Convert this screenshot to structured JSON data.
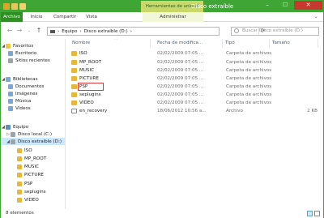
{
  "window": {
    "title": "Disco extraíble (D:)",
    "context_tab": "Herramientas de unidad",
    "accent": "#3fa535",
    "controls": {
      "minimize": "–",
      "maximize": "☐",
      "close": "✕"
    }
  },
  "ribbon": {
    "tabs": [
      "Archivo",
      "Inicio",
      "Compartir",
      "Vista",
      "Administrar"
    ]
  },
  "address": {
    "path": [
      "Equipo",
      "Disco extraíble (D:)"
    ],
    "search_placeholder": "Buscar Disco extraíble (D:)"
  },
  "nav_pane": {
    "favorites": {
      "label": "Favoritos",
      "items": [
        "Escritorio",
        "Sitios recientes"
      ]
    },
    "libraries": {
      "label": "Bibliotecas",
      "items": [
        "Documentos",
        "Imágenes",
        "Música",
        "Vídeos"
      ]
    },
    "computer": {
      "label": "Equipo",
      "drives": [
        "Disco local (C:)",
        "Disco extraíble (D:)"
      ],
      "subfolders": [
        "ISO",
        "MP_ROOT",
        "MUSIC",
        "PICTURE",
        "PSP",
        "seplugins",
        "VIDEO"
      ]
    }
  },
  "columns": {
    "name": "Nombre",
    "date": "Fecha de modifica...",
    "type": "Tipo",
    "size": "Tamaño"
  },
  "files": [
    {
      "name": "ISO",
      "date": "02/02/2009 07:05 ...",
      "type": "Carpeta de archivos",
      "size": "",
      "kind": "folder"
    },
    {
      "name": "MP_ROOT",
      "date": "02/02/2009 07:05 ...",
      "type": "Carpeta de archivos",
      "size": "",
      "kind": "folder"
    },
    {
      "name": "MUSIC",
      "date": "02/02/2009 07:05 ...",
      "type": "Carpeta de archivos",
      "size": "",
      "kind": "folder"
    },
    {
      "name": "PICTURE",
      "date": "02/02/2009 07:05 ...",
      "type": "Carpeta de archivos",
      "size": "",
      "kind": "folder"
    },
    {
      "name": "PSP",
      "date": "02/02/2009 07:05 ...",
      "type": "Carpeta de archivos",
      "size": "",
      "kind": "folder",
      "highlighted": true
    },
    {
      "name": "seplugins",
      "date": "02/02/2009 07:05 ...",
      "type": "Carpeta de archivos",
      "size": "",
      "kind": "folder"
    },
    {
      "name": "VIDEO",
      "date": "02/02/2009 07:05 ...",
      "type": "Carpeta de archivos",
      "size": "",
      "kind": "folder"
    },
    {
      "name": "en_recovery",
      "date": "18/06/2012 10:56 a...",
      "type": "Archivo",
      "size": "2 KB",
      "kind": "file"
    }
  ],
  "status": {
    "count": "8 elementos"
  }
}
